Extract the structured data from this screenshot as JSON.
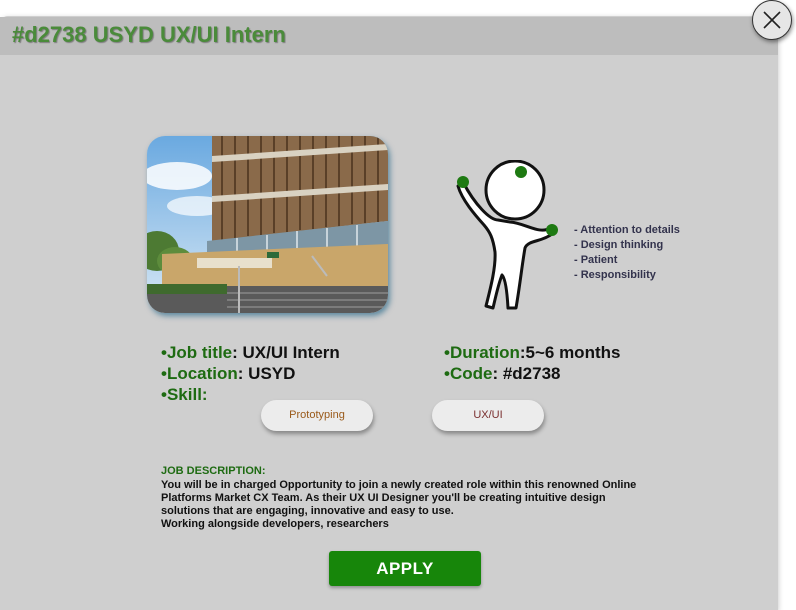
{
  "header": {
    "title": "#d2738 USYD UX/UI Intern"
  },
  "close": {
    "icon": "close-icon"
  },
  "image": {
    "description_icon": "building-photo"
  },
  "traits": [
    "- Attention to details",
    "- Design thinking",
    "- Patient",
    "- Responsibility"
  ],
  "job": {
    "title_label": "Job title",
    "title_value": ": UX/UI Intern",
    "location_label": "Location",
    "location_value": ": USYD",
    "skill_label": "Skill:",
    "duration_label": "Duration",
    "duration_value": ":5~6 months",
    "code_label": "Code",
    "code_value": ": #d2738",
    "bullet": "•"
  },
  "skills": [
    {
      "label": "Prototyping",
      "color": "#9a5a1a"
    },
    {
      "label": "UX/UI",
      "color": "#7a2f2f"
    }
  ],
  "description": {
    "heading": "JOB DESCRIPTION:",
    "lines": [
      "You will be in charged Opportunity to join a newly created role within this renowned Online",
      "Platforms Market CX Team. As their UX UI Designer you'll be creating intuitive design",
      "solutions that are engaging, innovative and easy to use.",
      "Working alongside developers, researchers"
    ]
  },
  "apply": {
    "label": "APPLY"
  },
  "colors": {
    "accent": "#1e6b12",
    "button": "#17860a",
    "title": "#4a8b3a"
  }
}
